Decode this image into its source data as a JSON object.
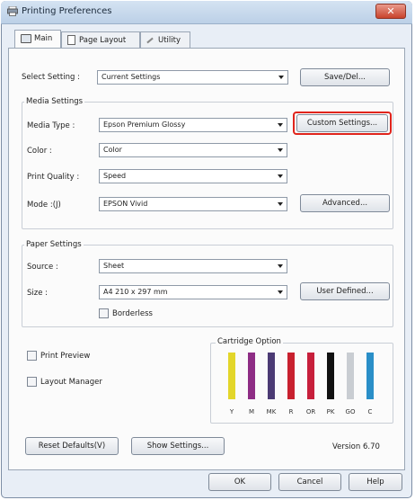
{
  "window": {
    "title": "Printing Preferences",
    "close_symbol": "✕",
    "accent_close": "#c8432c"
  },
  "tabs": [
    {
      "label": "Main",
      "icon": "printer-icon"
    },
    {
      "label": "Page Layout",
      "icon": "page-layout-icon"
    },
    {
      "label": "Utility",
      "icon": "wrench-icon"
    }
  ],
  "select_setting": {
    "label": "Select Setting :",
    "value": "Current Settings",
    "save_button": "Save/Del..."
  },
  "media_settings": {
    "title": "Media Settings",
    "media_type": {
      "label": "Media Type :",
      "value": "Epson Premium Glossy"
    },
    "custom_settings_button": "Custom Settings...",
    "color": {
      "label": "Color :",
      "value": "Color"
    },
    "print_quality": {
      "label": "Print Quality :",
      "value": "Speed"
    },
    "mode": {
      "label": "Mode :(J)",
      "value": "EPSON Vivid"
    },
    "advanced_button": "Advanced..."
  },
  "paper_settings": {
    "title": "Paper Settings",
    "source": {
      "label": "Source :",
      "value": "Sheet"
    },
    "size": {
      "label": "Size :",
      "value": "A4 210 x 297 mm"
    },
    "user_defined_button": "User Defined...",
    "borderless_label": "Borderless"
  },
  "print_preview_label": "Print Preview",
  "layout_manager_label": "Layout Manager",
  "cartridge": {
    "title": "Cartridge Option",
    "inks": [
      {
        "code": "Y",
        "color": "#e3d62a"
      },
      {
        "code": "M",
        "color": "#8e2d85"
      },
      {
        "code": "MK",
        "color": "#4b3a74"
      },
      {
        "code": "R",
        "color": "#c8202e"
      },
      {
        "code": "OR",
        "color": "#c71f3b"
      },
      {
        "code": "PK",
        "color": "#111111"
      },
      {
        "code": "GO",
        "color": "#c9cdd2"
      },
      {
        "code": "C",
        "color": "#2a8fc8"
      }
    ]
  },
  "footer": {
    "reset_button": "Reset Defaults(V)",
    "show_settings_button": "Show Settings...",
    "version": "Version 6.70"
  },
  "dialog_buttons": {
    "ok": "OK",
    "cancel": "Cancel",
    "help": "Help"
  }
}
